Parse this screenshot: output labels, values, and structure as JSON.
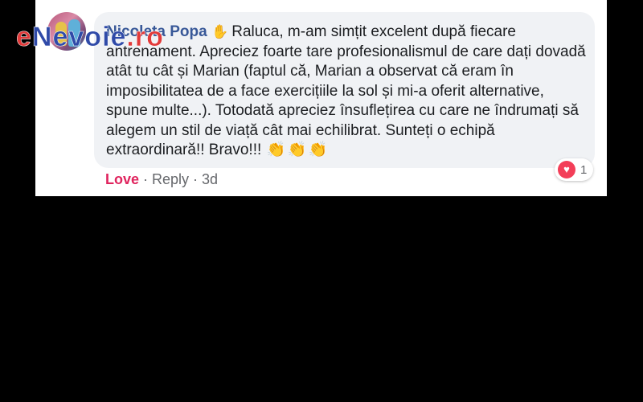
{
  "watermark": {
    "text_start": "e",
    "text_mid": "Nevoie",
    "text_end": ".ro"
  },
  "comment": {
    "author": "Nicoleta Popa",
    "emoji_after_name": "waving-hand-icon",
    "text": "Raluca, m-am simțit excelent după fiecare antrenament. Apreciez foarte tare profesionalismul de care dați dovadă atât tu cât și Marian (faptul că, Marian a observat că eram în imposibilitatea de a face exercițiile la sol și mi-a oferit alternative, spune multe...). Totodată apreciez însuflețirea cu care ne îndrumați să alegem un stil de viață cât mai echilibrat. Sunteți o echipă extraordinară!! Bravo!!!",
    "trailing_emojis": [
      "clapping-hands-icon",
      "clapping-hands-icon",
      "clapping-hands-icon"
    ]
  },
  "reactions": {
    "type": "love",
    "count": "1"
  },
  "actions": {
    "love": "Love",
    "reply": "Reply",
    "age": "3d",
    "separator": "·"
  },
  "colors": {
    "background": "#000000",
    "bubble": "#f0f2f5",
    "author": "#385898",
    "love": "#e0245e",
    "heart": "#f33e58",
    "meta": "#65676b"
  }
}
